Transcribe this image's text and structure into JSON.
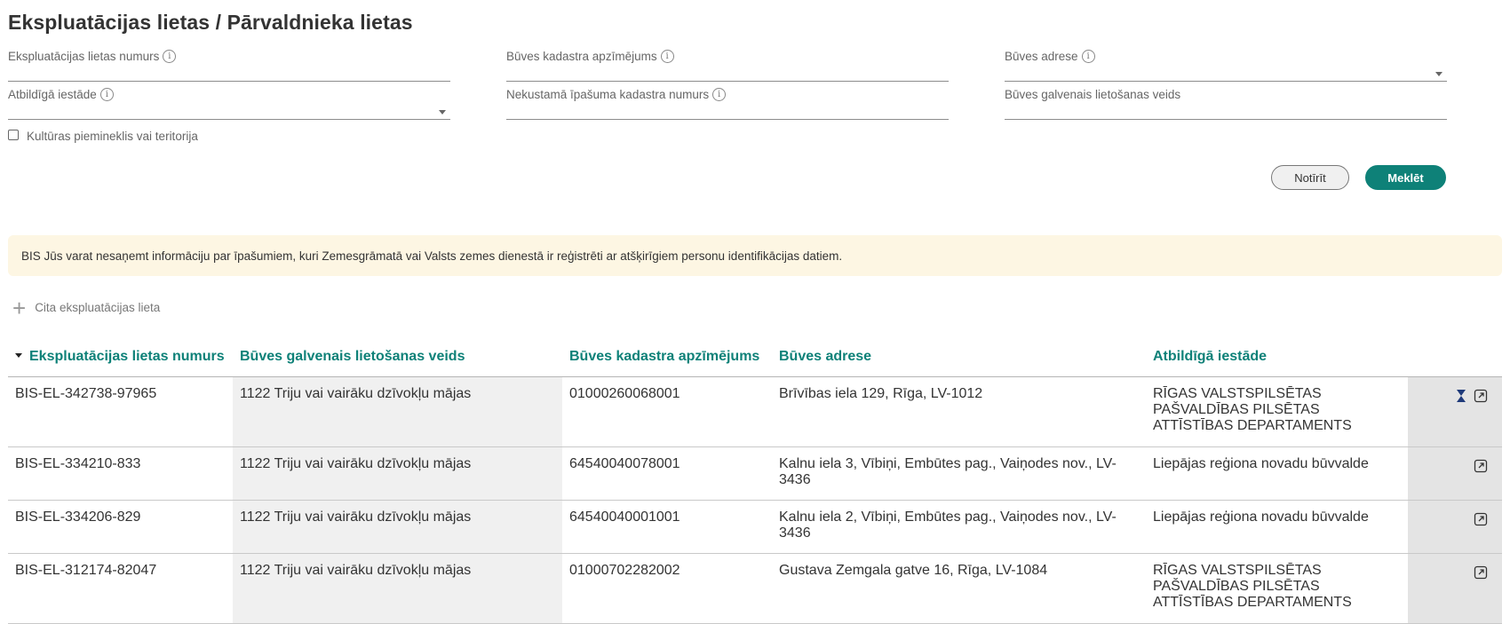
{
  "page": {
    "title": "Ekspluatācijas lietas / Pārvaldnieka lietas"
  },
  "filters": {
    "case_number": {
      "label": "Ekspluatācijas lietas numurs",
      "value": ""
    },
    "cadastre_designation": {
      "label": "Būves kadastra apzīmējums",
      "value": ""
    },
    "address": {
      "label": "Būves adrese",
      "value": ""
    },
    "responsible_authority": {
      "label": "Atbildīgā iestāde",
      "value": ""
    },
    "property_cadastre_number": {
      "label": "Nekustamā īpašuma kadastra numurs",
      "value": ""
    },
    "main_usage_type": {
      "label": "Būves galvenais lietošanas veids",
      "value": ""
    },
    "cultural_monument": {
      "label": "Kultūras piemineklis vai teritorija",
      "checked": false
    },
    "info_icon": "info-circle-icon",
    "dropdown_icon": "caret-down-icon"
  },
  "buttons": {
    "clear": "Notīrīt",
    "search": "Meklēt"
  },
  "notice": {
    "text": "BIS Jūs varat nesaņemt informāciju par īpašumiem, kuri Zemesgrāmatā vai Valsts zemes dienestā ir reģistrēti ar atšķirīgiem personu identifikācijas datiem."
  },
  "add_case": {
    "label": "Cita ekspluatācijas lieta",
    "icon": "plus-icon"
  },
  "table": {
    "columns": [
      "Ekspluatācijas lietas numurs",
      "Būves galvenais lietošanas veids",
      "Būves kadastra apzīmējums",
      "Būves adrese",
      "Atbildīgā iestāde"
    ],
    "rows": [
      {
        "number": "BIS-EL-342738-97965",
        "usage": "1122 Triju vai vairāku dzīvokļu mājas",
        "cadastre": "01000260068001",
        "address": "Brīvības iela 129, Rīga, LV-1012",
        "authority": "RĪGAS VALSTSPILSĒTAS PAŠVALDĪBAS PILSĒTAS ATTĪSTĪBAS DEPARTAMENTS"
      },
      {
        "number": "BIS-EL-334210-833",
        "usage": "1122 Triju vai vairāku dzīvokļu mājas",
        "cadastre": "64540040078001",
        "address": "Kalnu iela 3, Vībiņi, Embūtes pag., Vaiņodes nov., LV-3436",
        "authority": "Liepājas reģiona novadu būvvalde"
      },
      {
        "number": "BIS-EL-334206-829",
        "usage": "1122 Triju vai vairāku dzīvokļu mājas",
        "cadastre": "64540040001001",
        "address": "Kalnu iela 2, Vībiņi, Embūtes pag., Vaiņodes nov., LV-3436",
        "authority": "Liepājas reģiona novadu būvvalde"
      },
      {
        "number": "BIS-EL-312174-82047",
        "usage": "1122 Triju vai vairāku dzīvokļu mājas",
        "cadastre": "01000702282002",
        "address": "Gustava Zemgala gatve 16, Rīga, LV-1084",
        "authority": "RĪGAS VALSTSPILSĒTAS PAŠVALDĪBAS PILSĒTAS ATTĪSTĪBAS DEPARTAMENTS"
      }
    ]
  },
  "colors": {
    "accent": "#0e8178",
    "notice_bg": "#fdf6e3",
    "pin": "#1f3a7a"
  }
}
